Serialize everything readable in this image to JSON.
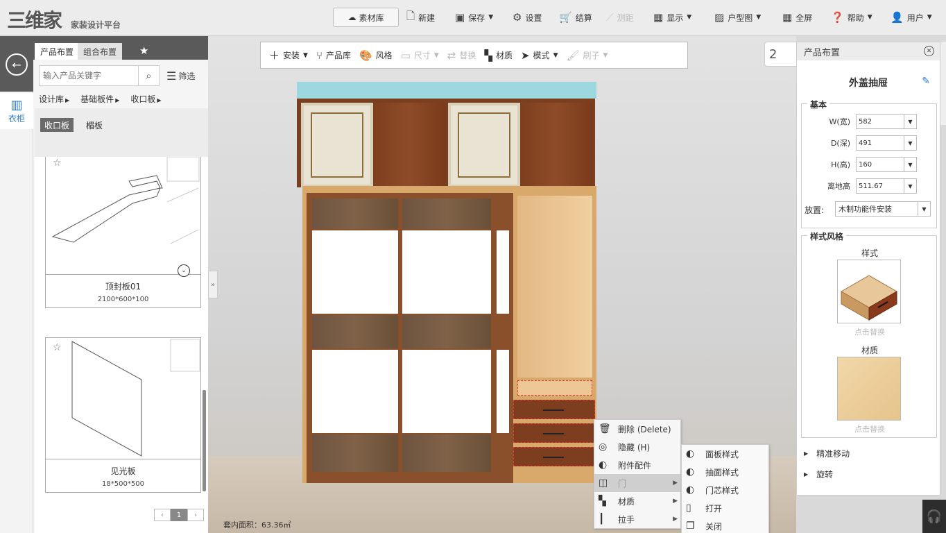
{
  "app": {
    "logo": "三维家",
    "subtitle": "家装设计平台"
  },
  "topbar": {
    "material_lib": "素材库",
    "new": "新建",
    "save": "保存",
    "settings": "设置",
    "checkout": "结算",
    "measure": "测距",
    "display": "显示",
    "floorplan": "户型图",
    "fullscreen": "全屏",
    "help": "帮助",
    "user": "用户"
  },
  "leftstrip": {
    "closet_label": "衣柜"
  },
  "leftpanel": {
    "tab_product": "产品布置",
    "tab_combo": "组合布置",
    "search_placeholder": "输入产品关键字",
    "filter": "筛选",
    "crumbs": [
      "设计库",
      "基础板件",
      "收口板"
    ],
    "subcats": [
      "收口板",
      "楣板"
    ],
    "cards": [
      {
        "name": "顶封板01",
        "size": "2100*600*100"
      },
      {
        "name": "见光板",
        "size": "18*500*500"
      }
    ],
    "pager": {
      "prev": "‹",
      "page": "1",
      "next": "›"
    }
  },
  "toolbar2": {
    "install": "安装",
    "product_lib": "产品库",
    "style": "风格",
    "size": "尺寸",
    "replace": "替换",
    "material": "材质",
    "mode": "模式",
    "brush": "刷子"
  },
  "canvas": {
    "area": "套内面积：63.36㎡",
    "floater": "2"
  },
  "context_menu": {
    "items": [
      {
        "label": "删除 (Delete)"
      },
      {
        "label": "隐藏 (H)"
      },
      {
        "label": "附件配件"
      },
      {
        "label": "门"
      },
      {
        "label": "材质"
      },
      {
        "label": "拉手"
      }
    ],
    "submenu": [
      {
        "label": "面板样式"
      },
      {
        "label": "抽面样式"
      },
      {
        "label": "门芯样式"
      },
      {
        "label": "打开"
      },
      {
        "label": "关闭"
      }
    ]
  },
  "rightpanel": {
    "title": "产品布置",
    "product_name": "外盖抽屉",
    "basic": "基本",
    "fields": [
      {
        "label": "W(宽)",
        "value": "582"
      },
      {
        "label": "D(深)",
        "value": "491"
      },
      {
        "label": "H(高)",
        "value": "160"
      },
      {
        "label": "离地高",
        "value": "511.67"
      }
    ],
    "place_label": "放置:",
    "place_value": "木制功能件安装",
    "style_section": "样式风格",
    "style_label": "样式",
    "style_replace": "点击替换",
    "material_label": "材质",
    "material_replace": "点击替换",
    "move": "精准移动",
    "rotate": "旋转"
  }
}
